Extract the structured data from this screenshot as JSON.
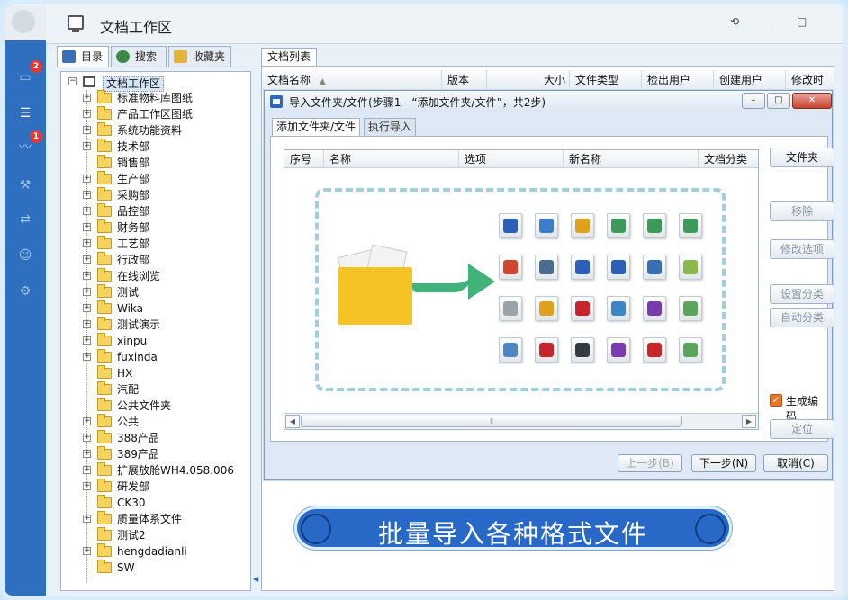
{
  "app": {
    "title": "文档工作区"
  },
  "rail": {
    "badges": [
      "2",
      "1"
    ]
  },
  "left_tabs": [
    "目录",
    "搜索",
    "收藏夹"
  ],
  "tree": {
    "root": "文档工作区",
    "items": [
      {
        "label": "标准物料库图纸",
        "exp": true
      },
      {
        "label": "产品工作区图纸",
        "exp": true
      },
      {
        "label": "系统功能资料",
        "exp": true
      },
      {
        "label": "技术部",
        "exp": true
      },
      {
        "label": "销售部",
        "exp": false
      },
      {
        "label": "生产部",
        "exp": true
      },
      {
        "label": "采购部",
        "exp": true
      },
      {
        "label": "品控部",
        "exp": true
      },
      {
        "label": "财务部",
        "exp": true
      },
      {
        "label": "工艺部",
        "exp": true
      },
      {
        "label": "行政部",
        "exp": true
      },
      {
        "label": "在线浏览",
        "exp": true
      },
      {
        "label": "测试",
        "exp": true
      },
      {
        "label": "Wika",
        "exp": true
      },
      {
        "label": "测试演示",
        "exp": true
      },
      {
        "label": "xinpu",
        "exp": true
      },
      {
        "label": "fuxinda",
        "exp": true
      },
      {
        "label": "HX",
        "exp": false
      },
      {
        "label": "汽配",
        "exp": false
      },
      {
        "label": "公共文件夹",
        "exp": false
      },
      {
        "label": "公共",
        "exp": true
      },
      {
        "label": "388产品",
        "exp": true
      },
      {
        "label": "389产品",
        "exp": true
      },
      {
        "label": "扩展放舱WH4.058.006",
        "exp": true
      },
      {
        "label": "研发部",
        "exp": true
      },
      {
        "label": "CK30",
        "exp": false
      },
      {
        "label": "质量体系文件",
        "exp": true
      },
      {
        "label": "测试2",
        "exp": false
      },
      {
        "label": "hengdadianli",
        "exp": true
      },
      {
        "label": "SW",
        "exp": false
      }
    ]
  },
  "doclist": {
    "tab": "文档列表",
    "columns": [
      "文档名称",
      "版本",
      "大小",
      "文件类型",
      "检出用户",
      "创建用户",
      "修改时间"
    ],
    "sort_indicator": "▲"
  },
  "dialog": {
    "title": "导入文件夹/文件(步骤1 - “添加文件夹/文件”，共2步)",
    "tabs": [
      "添加文件夹/文件",
      "执行导入"
    ],
    "grid_columns": [
      "序号",
      "名称",
      "选项",
      "新名称",
      "文档分类"
    ],
    "side_buttons": {
      "folder": "文件夹",
      "remove": "移除",
      "modify": "修改选项",
      "set_category": "设置分类",
      "auto_category": "自动分类",
      "locate": "定位"
    },
    "checkbox": {
      "label": "生成编码",
      "checked": true
    },
    "footer": {
      "prev": "上一步(B)",
      "next": "下一步(N)",
      "cancel": "取消(C)"
    }
  },
  "banner": {
    "text": "批量导入各种格式文件"
  },
  "colors": {
    "rail": "#2f6fbf",
    "banner": "#2869c7",
    "arrow": "#3fb37a",
    "folder": "#f6c324",
    "dash": "#9fd0dc"
  }
}
